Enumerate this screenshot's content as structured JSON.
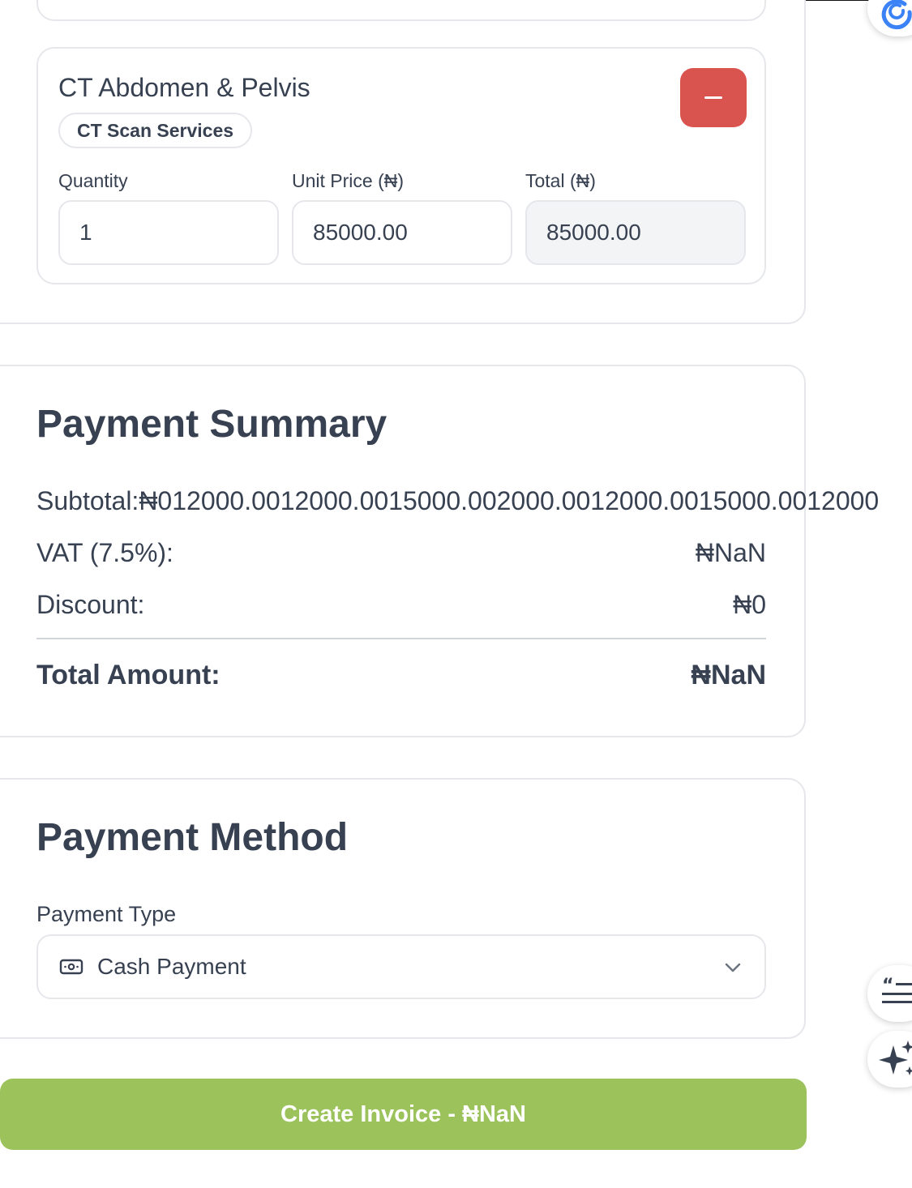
{
  "item": {
    "name": "CT Abdomen & Pelvis",
    "category": "CT Scan Services",
    "remove_label": "−",
    "quantity_label": "Quantity",
    "quantity": "1",
    "unit_price_label": "Unit Price (₦)",
    "unit_price": "85000.00",
    "total_label": "Total (₦)",
    "total": "85000.00"
  },
  "summary": {
    "title": "Payment Summary",
    "subtotal_text": "Subtotal:₦012000.0012000.0015000.002000.0012000.0015000.0012000",
    "vat_label": "VAT (7.5%):",
    "vat_value": "₦NaN",
    "discount_label": "Discount:",
    "discount_value": "₦0",
    "total_label": "Total Amount:",
    "total_value": "₦NaN"
  },
  "payment_method": {
    "title": "Payment Method",
    "type_label": "Payment Type",
    "selected": "Cash Payment",
    "icon": "cash-icon"
  },
  "actions": {
    "create_invoice": "Create Invoice - ₦NaN"
  },
  "colors": {
    "remove": "#d9534f",
    "create": "#9bc25b",
    "text": "#374151",
    "border": "#e5e7eb",
    "readonly_bg": "#f3f4f6"
  }
}
